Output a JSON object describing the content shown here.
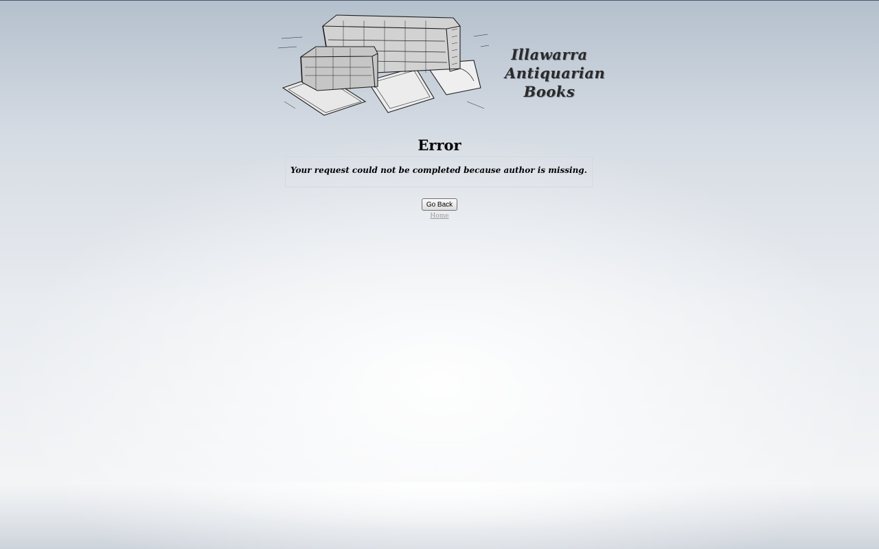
{
  "header": {
    "site_title_lines": [
      "Illawarra",
      "Antiquarian",
      "Books"
    ],
    "banner_icon": "antique-books-illustration"
  },
  "main": {
    "heading": "Error",
    "message": "Your request could not be completed because author is missing."
  },
  "actions": {
    "go_back_label": "Go Back",
    "home_link_label": "Home"
  },
  "colors": {
    "background_top": "#b4c0cd",
    "background_bottom": "#f4f5f7",
    "text": "#000000",
    "link": "#9a9a9a"
  }
}
